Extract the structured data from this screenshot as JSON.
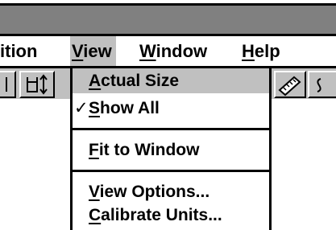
{
  "menubar": {
    "items": [
      {
        "pre": "ition",
        "ul": "",
        "post": ""
      },
      {
        "pre": "",
        "ul": "V",
        "post": "iew"
      },
      {
        "pre": "",
        "ul": "W",
        "post": "indow"
      },
      {
        "pre": "",
        "ul": "H",
        "post": "elp"
      }
    ]
  },
  "toolbar": {
    "buttons": [
      "partial-tool-icon",
      "bucket-arrows-icon",
      "ruler-icon",
      "partial-tool-icon"
    ]
  },
  "view_menu": {
    "items": [
      {
        "check": "",
        "ul": "A",
        "post": "ctual Size",
        "highlighted": true
      },
      {
        "check": "✓",
        "ul": "S",
        "post": "how All",
        "highlighted": false
      },
      {
        "check": "",
        "ul": "F",
        "post": "it to Window",
        "highlighted": false
      },
      {
        "check": "",
        "ul": "V",
        "post": "iew Options...",
        "highlighted": false
      },
      {
        "check": "",
        "ul": "C",
        "post": "alibrate Units...",
        "highlighted": false
      }
    ]
  },
  "colors": {
    "titlebar": "#808080",
    "menu_highlight": "#c0c0c0",
    "toolbar": "#c0c0c0"
  }
}
